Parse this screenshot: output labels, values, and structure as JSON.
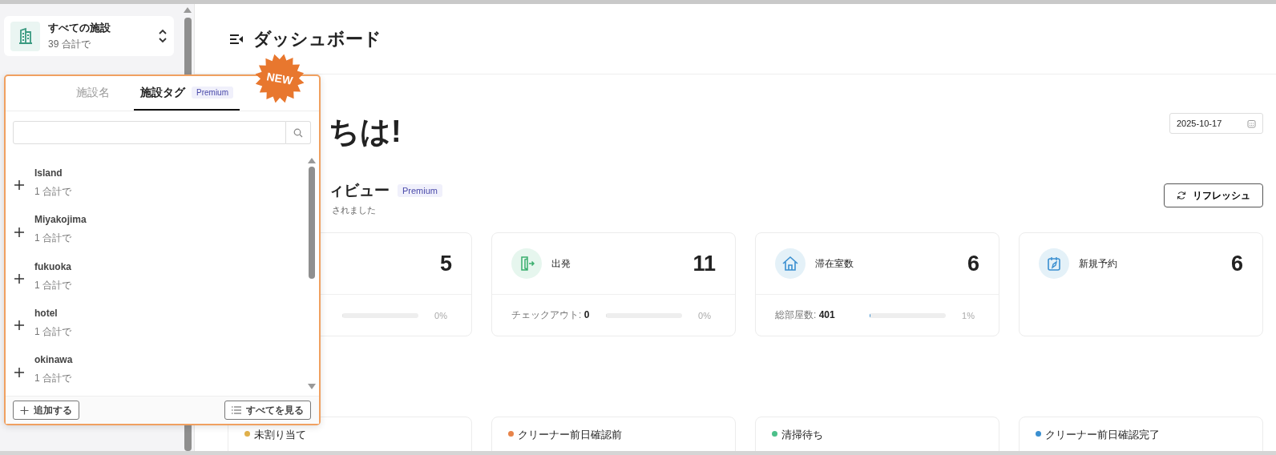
{
  "facility_selector": {
    "title": "すべての施設",
    "count": "39 合計で"
  },
  "page_title": "ダッシュボード",
  "greeting": "ちは!",
  "date_field": {
    "value": "2025-10-17"
  },
  "overview": {
    "title": "ィビュー",
    "badge": "Premium",
    "subtitle": "されました",
    "refresh_button": "リフレッシュ"
  },
  "stat_cards": [
    {
      "kind": "partial",
      "value": "5",
      "level": 0,
      "percent": "0%"
    },
    {
      "kind": "departure",
      "label": "出発",
      "value": "11",
      "detail_label": "チェックアウト:",
      "detail_value": "0",
      "level": 0,
      "percent": "0%"
    },
    {
      "kind": "stay",
      "label": "滞在室数",
      "value": "6",
      "detail_label": "総部屋数:",
      "detail_value": "401",
      "level": 0.01,
      "percent": "1%"
    },
    {
      "kind": "booking",
      "label": "新規予約",
      "value": "6"
    }
  ],
  "status_cards": [
    {
      "label": "未割り当て",
      "color": "#e0b04a"
    },
    {
      "label": "クリーナー前日確認前",
      "color": "#e8844a"
    },
    {
      "label": "清掃待ち",
      "color": "#4cc08a"
    },
    {
      "label": "クリーナー前日確認完了",
      "color": "#3a8fd0"
    }
  ],
  "popup": {
    "new_badge": "NEW",
    "tabs": [
      {
        "label": "施設名",
        "selected": false
      },
      {
        "label": "施設タグ",
        "selected": true,
        "badge": "Premium"
      }
    ],
    "tags": [
      {
        "name": "Island",
        "count": "1 合計で"
      },
      {
        "name": "Miyakojima",
        "count": "1 合計で"
      },
      {
        "name": "fukuoka",
        "count": "1 合計で"
      },
      {
        "name": "hotel",
        "count": "1 合計で"
      },
      {
        "name": "okinawa",
        "count": "1 合計で"
      }
    ],
    "add_button": "追加する",
    "view_all_button": "すべてを見る"
  }
}
